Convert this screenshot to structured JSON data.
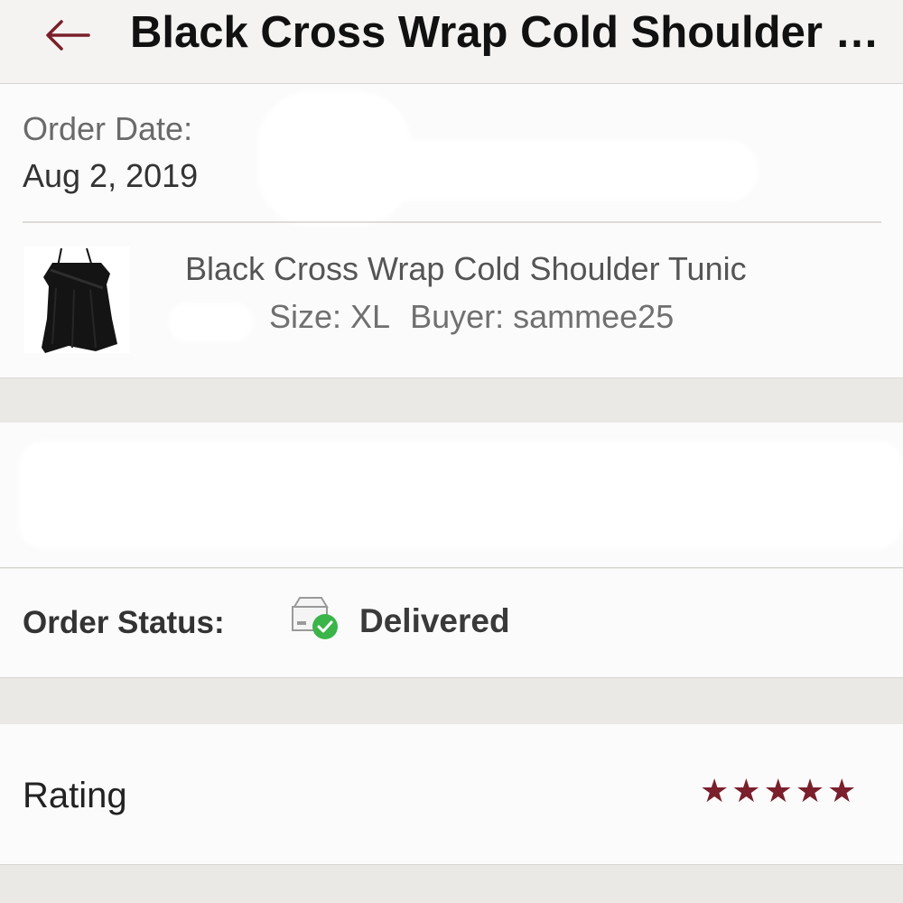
{
  "header": {
    "back_icon": "arrow-left-icon",
    "title": "Black Cross Wrap Cold Shoulder Tunic",
    "accent": "#7a1f2b"
  },
  "order": {
    "date_label": "Order Date:",
    "date_value": "Aug 2, 2019",
    "item": {
      "thumbnail": "black-tunic-photo",
      "title": "Black Cross Wrap Cold Shoulder Tunic",
      "size": "Size: XL",
      "buyer": "Buyer: sammee25"
    }
  },
  "status": {
    "label": "Order Status:",
    "icon": "package-delivered-icon",
    "value": "Delivered",
    "check_color": "#3bb54a"
  },
  "rating": {
    "label": "Rating",
    "stars": 5,
    "max": 5,
    "star_color": "#7a1f2b"
  }
}
